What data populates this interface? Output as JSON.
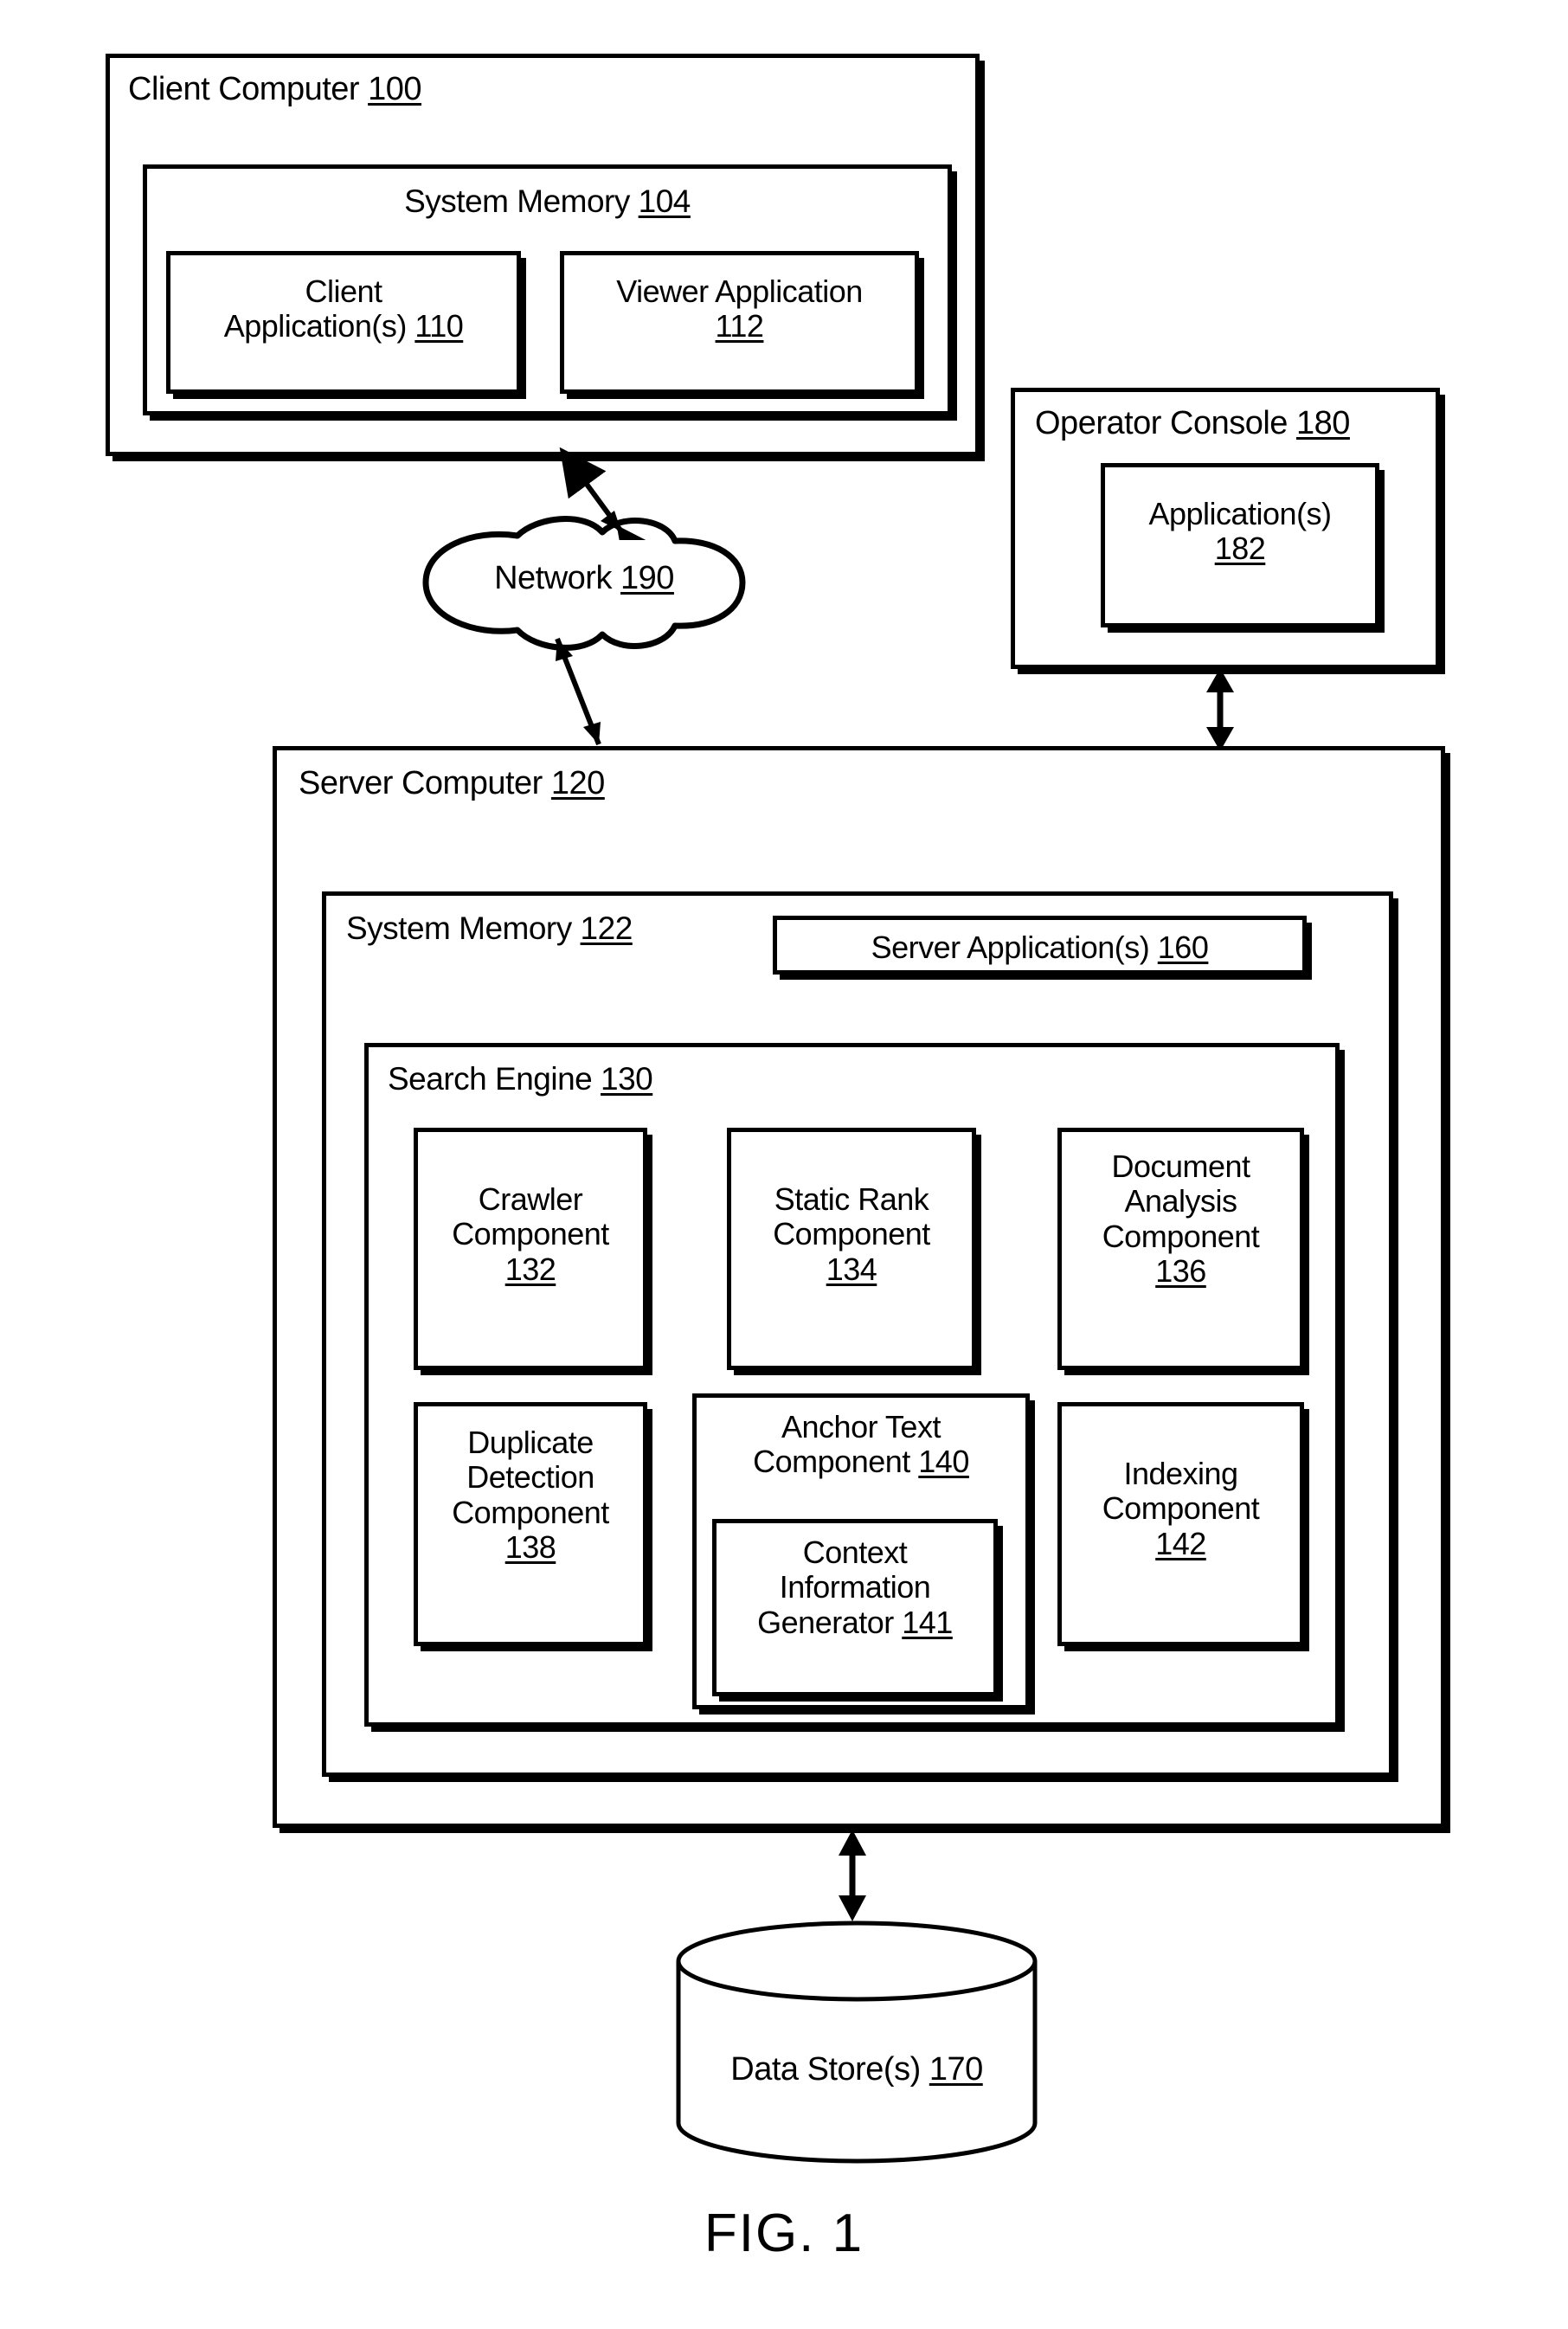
{
  "figure": {
    "caption": "FIG. 1"
  },
  "client_computer": {
    "title": "Client Computer",
    "ref": "100",
    "system_memory": {
      "title": "System Memory",
      "ref": "104",
      "boxes": [
        {
          "line1": "Client",
          "line2": "Application(s)",
          "ref": "110",
          "inline_ref": true
        },
        {
          "line1": "Viewer Application",
          "line2": "",
          "ref": "112",
          "inline_ref": false
        }
      ]
    }
  },
  "network": {
    "title": "Network",
    "ref": "190"
  },
  "operator_console": {
    "title": "Operator Console",
    "ref": "180",
    "application": {
      "line1": "Application(s)",
      "ref": "182"
    }
  },
  "server_computer": {
    "title": "Server Computer",
    "ref": "120",
    "system_memory": {
      "title": "System Memory",
      "ref": "122"
    },
    "server_application": {
      "title": "Server Application(s)",
      "ref": "160"
    },
    "search_engine": {
      "title": "Search Engine",
      "ref": "130",
      "components_row1": [
        {
          "line1": "Crawler",
          "line2": "Component",
          "ref": "132"
        },
        {
          "line1": "Static Rank",
          "line2": "Component",
          "ref": "134"
        },
        {
          "line1": "Document",
          "line2": "Analysis",
          "line3": "Component",
          "ref": "136"
        }
      ],
      "components_row2": [
        {
          "line1": "Duplicate",
          "line2": "Detection",
          "line3": "Component",
          "ref": "138"
        },
        {
          "line1": "Indexing",
          "line2": "Component",
          "ref": "142"
        }
      ],
      "anchor_text": {
        "line1": "Anchor Text",
        "line2": "Component",
        "ref": "140",
        "nested": {
          "line1": "Context",
          "line2": "Information",
          "line3": "Generator",
          "ref": "141"
        }
      }
    }
  },
  "data_store": {
    "title": "Data Store(s)",
    "ref": "170"
  }
}
